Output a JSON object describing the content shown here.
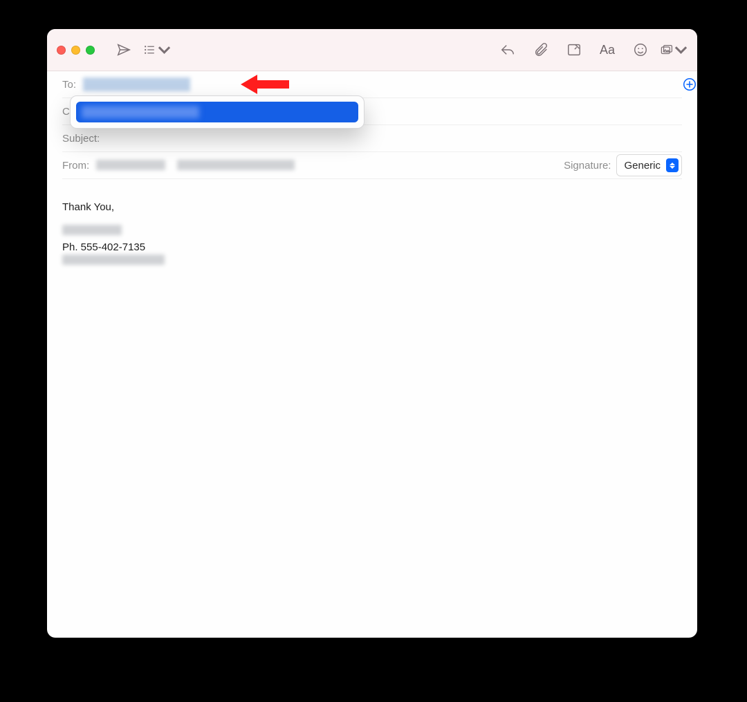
{
  "toolbar": {
    "traffic": {
      "close": "close",
      "minimize": "minimize",
      "zoom": "zoom"
    },
    "send_tooltip": "Send",
    "format_tooltip": "Header Options",
    "reply_tooltip": "Reply",
    "attach_tooltip": "Attach",
    "markup_tooltip": "Markup",
    "fonts_tooltip": "Format",
    "fonts_glyph": "Aa",
    "emoji_tooltip": "Emoji & Symbols",
    "media_tooltip": "Photo Browser"
  },
  "fields": {
    "to_label": "To:",
    "to_value_redacted": true,
    "cc_label": "Cc:",
    "subject_label": "Subject:",
    "subject_value": "",
    "from_label": "From:",
    "from_name_redacted": true,
    "from_email_redacted": true,
    "signature_label": "Signature:",
    "signature_value": "Generic",
    "add_recipient_tooltip": "Add Contact"
  },
  "autocomplete": {
    "suggestion_redacted": true
  },
  "body": {
    "greeting": "Thank You,",
    "line1_redacted": true,
    "phone_line": "Ph. 555-402-7135",
    "line3_redacted": true
  },
  "annotation": {
    "arrow_points_to": "to-field"
  }
}
